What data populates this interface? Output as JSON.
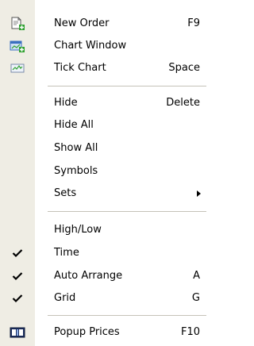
{
  "menu": {
    "items": [
      {
        "label": "New Order",
        "shortcut": "F9",
        "icon": "new-order-icon"
      },
      {
        "label": "Chart Window",
        "shortcut": "",
        "icon": "chart-window-icon"
      },
      {
        "label": "Tick Chart",
        "shortcut": "Space",
        "icon": "tick-chart-icon"
      },
      {
        "label": "Hide",
        "shortcut": "Delete"
      },
      {
        "label": "Hide All",
        "shortcut": ""
      },
      {
        "label": "Show All",
        "shortcut": ""
      },
      {
        "label": "Symbols",
        "shortcut": ""
      },
      {
        "label": "Sets",
        "shortcut": "",
        "submenu": true
      },
      {
        "label": "High/Low",
        "shortcut": "",
        "checked": false
      },
      {
        "label": "Time",
        "shortcut": "",
        "checked": true
      },
      {
        "label": "Auto Arrange",
        "shortcut": "A",
        "checked": true
      },
      {
        "label": "Grid",
        "shortcut": "G",
        "checked": true
      },
      {
        "label": "Popup Prices",
        "shortcut": "F10",
        "icon": "popup-prices-icon"
      }
    ]
  },
  "colors": {
    "gutter": "#efede4",
    "separator": "#c5c2b8",
    "icon_green": "#2fa12f",
    "icon_blue": "#3a6fc0",
    "icon_dark": "#1d2f5f"
  }
}
